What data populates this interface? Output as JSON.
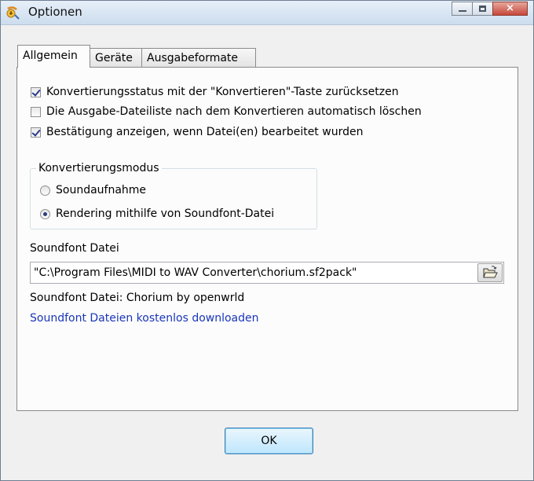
{
  "window": {
    "title": "Optionen",
    "icon": "converter-app-icon",
    "controls": {
      "minimize": "minimize-icon",
      "maximize": "maximize-icon",
      "close": "×"
    }
  },
  "tabs": [
    {
      "label": "Allgemein",
      "active": true
    },
    {
      "label": "Geräte",
      "active": false
    },
    {
      "label": "Ausgabeformate",
      "active": false
    }
  ],
  "general": {
    "checkboxes": [
      {
        "label": "Konvertierungsstatus mit der \"Konvertieren\"-Taste zurücksetzen",
        "checked": true
      },
      {
        "label": "Die Ausgabe-Dateiliste nach dem Konvertieren automatisch löschen",
        "checked": false
      },
      {
        "label": "Bestätigung anzeigen, wenn Datei(en) bearbeitet wurden",
        "checked": true
      }
    ],
    "mode_group": {
      "label": "Konvertierungsmodus",
      "options": [
        {
          "label": "Soundaufnahme",
          "selected": false
        },
        {
          "label": "Rendering mithilfe von Soundfont-Datei",
          "selected": true
        }
      ]
    },
    "soundfont": {
      "label": "Soundfont Datei",
      "path": "\"C:\\Program Files\\MIDI to WAV Converter\\chorium.sf2pack\"",
      "browse_icon": "open-folder-icon",
      "info": "Soundfont Datei: Chorium by openwrld",
      "download_link": "Soundfont Dateien kostenlos downloaden"
    }
  },
  "ok_button": "OK",
  "colors": {
    "link": "#1a36b8",
    "titlebar": "#d6e4f2",
    "close_button": "#c6483a"
  }
}
